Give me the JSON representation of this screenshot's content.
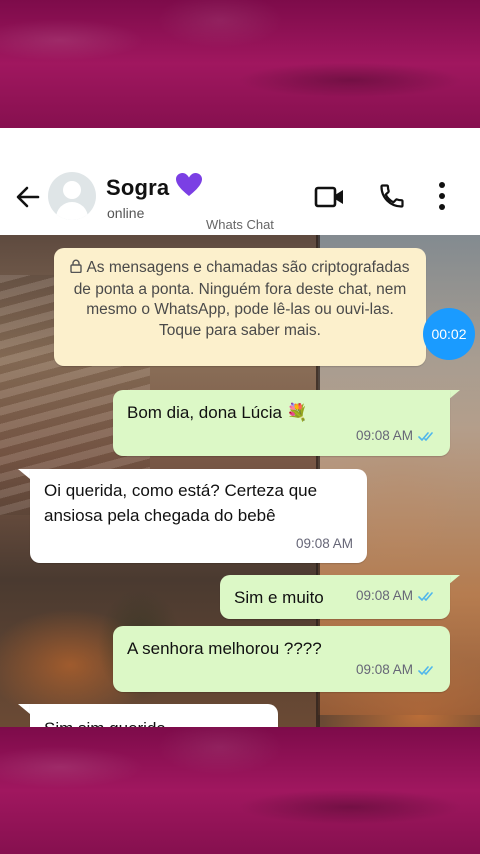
{
  "header": {
    "contact_name": "Sogra",
    "contact_emoji_icon": "purple-heart-icon",
    "status": "online",
    "watermark": "Whats Chat",
    "icons": {
      "back": "arrow-left-icon",
      "video": "video-camera-icon",
      "call": "phone-icon",
      "menu": "more-vertical-icon"
    }
  },
  "chat": {
    "encryption_notice": "As mensagens e chamadas são criptografadas de ponta a ponta. Ninguém fora deste chat, nem mesmo o WhatsApp, pode lê-las ou ouvi-las. Toque para saber mais.",
    "timer": "00:02",
    "messages": [
      {
        "direction": "outgoing",
        "text": "Bom dia, dona Lúcia 💐",
        "time": "09:08 AM",
        "read": true
      },
      {
        "direction": "incoming",
        "text": "Oi querida, como está? Certeza que ansiosa pela chegada do bebê",
        "time": "09:08 AM"
      },
      {
        "direction": "outgoing",
        "text": "Sim e muito",
        "time": "09:08 AM",
        "read": true
      },
      {
        "direction": "outgoing",
        "text": "A senhora melhorou ????",
        "time": "09:08 AM",
        "read": true
      },
      {
        "direction": "incoming",
        "text": "Sim sim querida",
        "time": ""
      }
    ]
  },
  "colors": {
    "frame_magenta": "#8a0f52",
    "outgoing_bubble": "#dcf8c6",
    "incoming_bubble": "#ffffff",
    "notice_bubble": "#fcf0cc",
    "read_ticks": "#4fb6ec",
    "timer_badge": "#1a9bff",
    "heart": "#7b3fe4"
  }
}
